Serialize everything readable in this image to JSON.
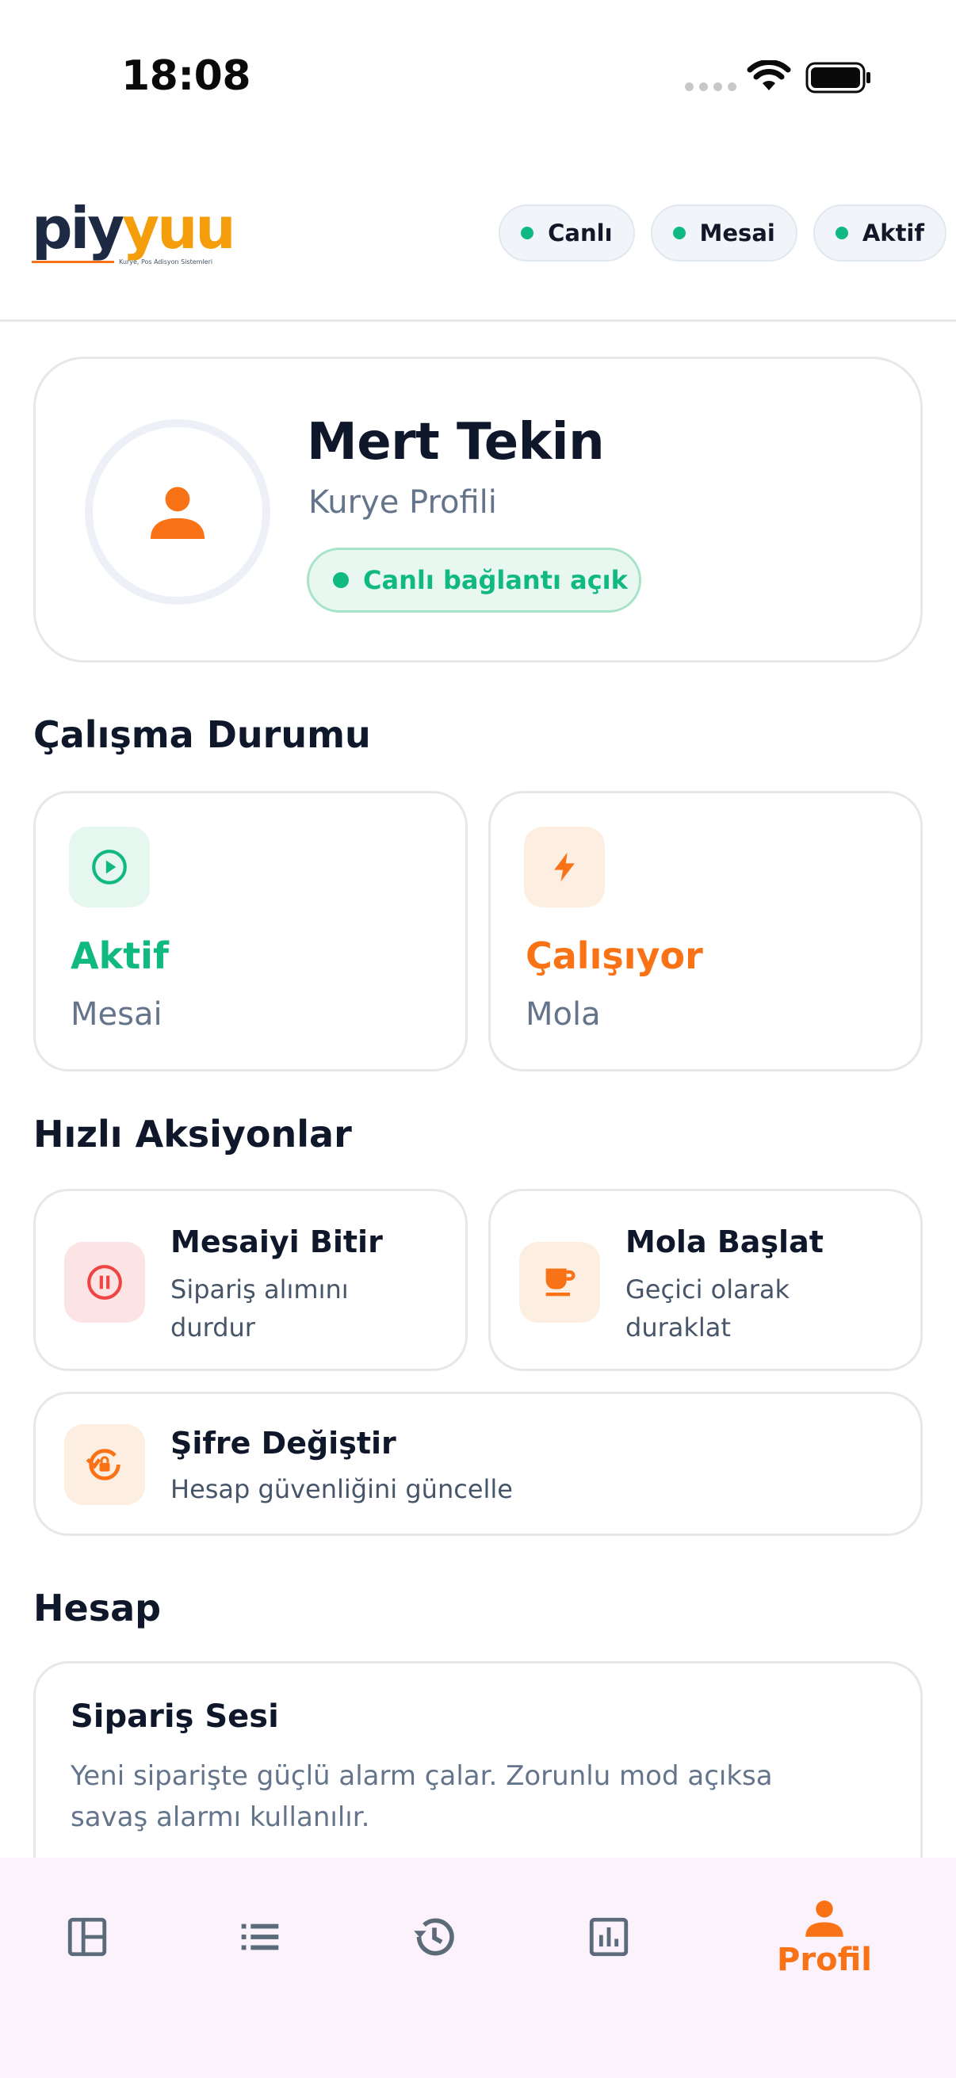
{
  "status_bar": {
    "time": "18:08"
  },
  "header": {
    "logo_dark": "piy",
    "logo_orange": "yuu",
    "logo_tagline": "Kurye, Pos Adisyon Sistemleri",
    "chips": [
      {
        "label": "Canlı"
      },
      {
        "label": "Mesai"
      },
      {
        "label": "Aktif"
      }
    ]
  },
  "profile": {
    "name": "Mert Tekin",
    "role": "Kurye Profili",
    "live_status": "Canlı bağlantı açık"
  },
  "work_status": {
    "title": "Çalışma Durumu",
    "cards": [
      {
        "value": "Aktif",
        "label": "Mesai",
        "icon": "play-circle-icon",
        "color": "#10b981"
      },
      {
        "value": "Çalışıyor",
        "label": "Mola",
        "icon": "bolt-icon",
        "color": "#f97316"
      }
    ]
  },
  "quick_actions": {
    "title": "Hızlı Aksiyonlar",
    "items": [
      {
        "title": "Mesaiyi Bitir",
        "subtitle_line1": "Sipariş alımını",
        "subtitle_line2": "durdur",
        "icon": "pause-circle-icon"
      },
      {
        "title": "Mola Başlat",
        "subtitle_line1": "Geçici olarak",
        "subtitle_line2": "duraklat",
        "icon": "coffee-cup-icon"
      },
      {
        "title": "Şifre Değiştir",
        "subtitle": "Hesap güvenliğini güncelle",
        "icon": "lock-reset-icon"
      }
    ]
  },
  "account": {
    "title": "Hesap",
    "sound_title": "Sipariş Sesi",
    "sound_desc_line1": "Yeni siparişte güçlü alarm çalar. Zorunlu mod açıksa",
    "sound_desc_line2": "savaş alarmı kullanılır."
  },
  "bottom_nav": {
    "items": [
      {
        "icon": "dashboard-icon"
      },
      {
        "icon": "list-icon"
      },
      {
        "icon": "history-icon"
      },
      {
        "icon": "chart-icon"
      },
      {
        "icon": "person-icon",
        "label": "Profil",
        "active": true
      }
    ]
  },
  "colors": {
    "accent": "#f97316",
    "success": "#10b981",
    "danger": "#ef4444"
  }
}
